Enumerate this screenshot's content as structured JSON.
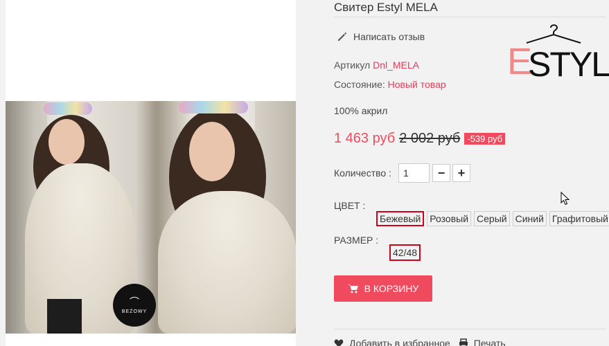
{
  "product": {
    "title": "Свитер Estyl MELA",
    "review_link": "Написать отзыв",
    "sku_label": "Артикул",
    "sku_value": "Dnl_MELA",
    "condition_label": "Состояние:",
    "condition_value": "Новый товар",
    "composition": "100% акрил",
    "price_new": "1 463 руб",
    "price_old": "2 002 руб",
    "discount": "-539 руб",
    "quantity_label": "Количество :",
    "quantity_value": "1",
    "minus": "−",
    "plus": "+",
    "color_label": "ЦВЕТ :",
    "colors": [
      "Бежевый",
      "Розовый",
      "Серый",
      "Синий",
      "Графитовый"
    ],
    "selected_color": "Бежевый",
    "size_label": "РАЗМЕР :",
    "size_value": "42/48",
    "cart_button": "В КОРЗИНУ"
  },
  "brand": {
    "logo_e": "E",
    "logo_rest": "STYL",
    "accent": "#f08a8a"
  },
  "gallery": {
    "badge_text": "BEŻOWY"
  },
  "bottom": {
    "favorites": "Добавить в избранное",
    "print": "Печать"
  },
  "colors": {
    "accent": "#f04a5e",
    "selection": "#d0021b"
  },
  "icons": {
    "review": "pencil-icon",
    "cart": "shopping-cart-icon",
    "favorites": "heart-icon",
    "print": "printer-icon"
  }
}
